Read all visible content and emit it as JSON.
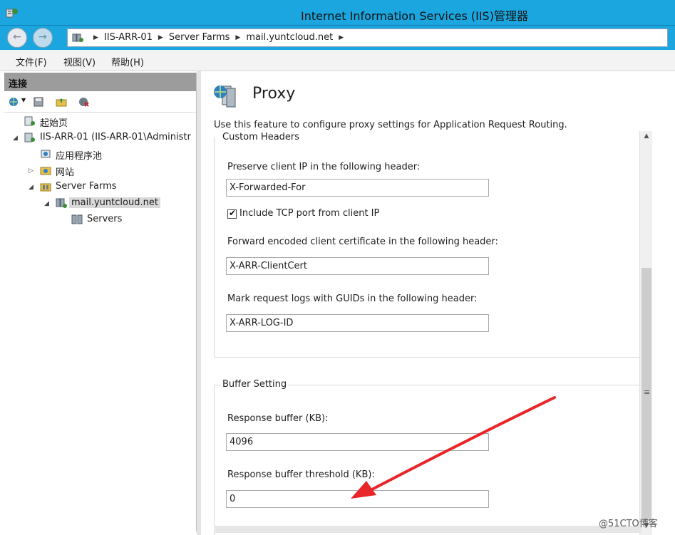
{
  "window": {
    "title": "Internet Information Services (IIS)管理器"
  },
  "address": {
    "crumbs": [
      "IIS-ARR-01",
      "Server Farms",
      "mail.yuntcloud.net"
    ]
  },
  "menu": {
    "items": [
      "文件(F)",
      "视图(V)",
      "帮助(H)"
    ]
  },
  "connections": {
    "header": "连接",
    "tree": [
      {
        "label": "起始页"
      },
      {
        "label": "IIS-ARR-01 (IIS-ARR-01\\Administr"
      },
      {
        "label": "应用程序池"
      },
      {
        "label": "网站"
      },
      {
        "label": "Server Farms"
      },
      {
        "label": "mail.yuntcloud.net"
      },
      {
        "label": "Servers"
      }
    ]
  },
  "feature": {
    "title": "Proxy",
    "description": "Use this feature to configure proxy settings for Application Request Routing."
  },
  "custom_headers": {
    "group_title": "Custom Headers",
    "preserve_label": "Preserve client IP in the following header:",
    "preserve_value": "X-Forwarded-For",
    "include_tcp_label": "Include TCP port from client IP",
    "include_tcp_checked": true,
    "forward_cert_label": "Forward encoded client certificate in the following header:",
    "forward_cert_value": "X-ARR-ClientCert",
    "mark_logs_label": "Mark request logs with GUIDs in the following header:",
    "mark_logs_value": "X-ARR-LOG-ID"
  },
  "buffer_setting": {
    "group_title": "Buffer Setting",
    "response_buffer_label": "Response buffer (KB):",
    "response_buffer_value": "4096",
    "threshold_label": "Response buffer threshold (KB):",
    "threshold_value": "0"
  },
  "watermark": "@51CTO博客",
  "colors": {
    "titlebar": "#1ca6df",
    "annotation_arrow": "#e8262a"
  }
}
